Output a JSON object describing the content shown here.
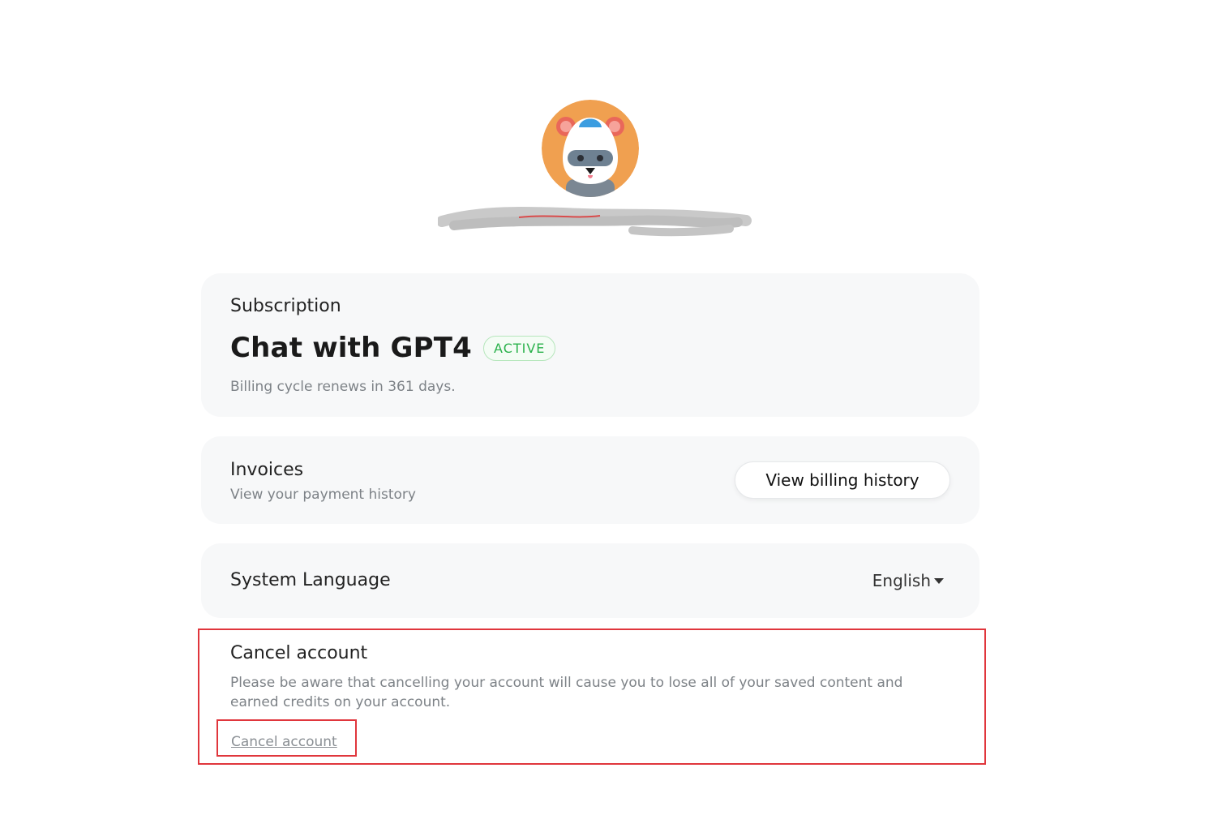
{
  "profile": {
    "avatar_icon": "hamster-avatar-icon"
  },
  "subscription": {
    "label": "Subscription",
    "plan_name": "Chat with GPT4",
    "status": "ACTIVE",
    "billing_note": "Billing cycle renews in 361 days."
  },
  "invoices": {
    "title": "Invoices",
    "subtitle": "View your payment history",
    "button_label": "View billing history"
  },
  "language": {
    "title": "System Language",
    "selected": "English"
  },
  "cancel": {
    "title": "Cancel account",
    "warning": "Please be aware that cancelling your account will cause you to lose all of your saved content and earned credits on your account.",
    "link_label": "Cancel account"
  },
  "colors": {
    "card_bg": "#f7f8f9",
    "active_green": "#2bb24c",
    "highlight_red": "#e0363c",
    "avatar_orange": "#f0a050"
  }
}
